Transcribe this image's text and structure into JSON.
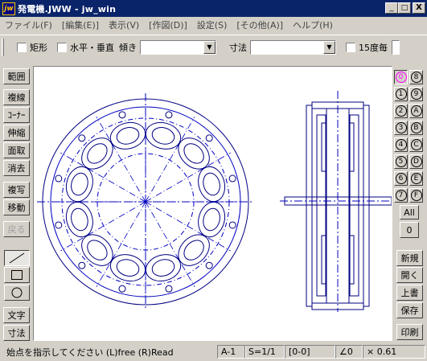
{
  "window": {
    "icon_text": "jw",
    "title": "発電機.JWW - jw_win",
    "minimize": "_",
    "maximize": "□",
    "close": "X"
  },
  "menu": [
    "ファイル(F)",
    "[編集(E)]",
    "表示(V)",
    "[作図(D)]",
    "設定(S)",
    "[その他(A)]",
    "ヘルプ(H)"
  ],
  "toolbar": {
    "rect_label": "矩形",
    "hv_label": "水平・垂直",
    "slope_label": "傾き",
    "slope_value": "",
    "dim_label": "寸法",
    "dim_value": "",
    "deg15_label": "15度毎"
  },
  "left_tools": {
    "range": "範囲",
    "copyline": "複線",
    "corner": "ｺｰﾅｰ",
    "stretch": "伸縮",
    "chamfer": "面取",
    "erase": "消去",
    "copy": "複写",
    "move": "移動",
    "undo": "戻る",
    "text": "文字",
    "dimension": "寸法"
  },
  "draw_tools": [
    "line",
    "rectangle",
    "circle"
  ],
  "layers": {
    "left": [
      "0",
      "1",
      "2",
      "3",
      "4",
      "5",
      "6",
      "7"
    ],
    "right": [
      "8",
      "9",
      "A",
      "B",
      "C",
      "D",
      "E",
      "F"
    ],
    "active": "0",
    "all_label": "All",
    "zero_label": "0"
  },
  "right_tools": {
    "new": "新規",
    "open": "開く",
    "overwrite": "上書",
    "save": "保存",
    "print": "印刷"
  },
  "status": {
    "message": "始点を指示してください (L)free (R)Read",
    "paper": "A-1",
    "scale": "S=1/1",
    "group": "[0-0]",
    "angle": "∠0",
    "zoom": "× 0.61"
  },
  "colors": {
    "titlebar": "#0a246a",
    "drawing_blue": "#0000c0",
    "drawing_navy": "#000080",
    "active_layer": "#ff00ff"
  }
}
